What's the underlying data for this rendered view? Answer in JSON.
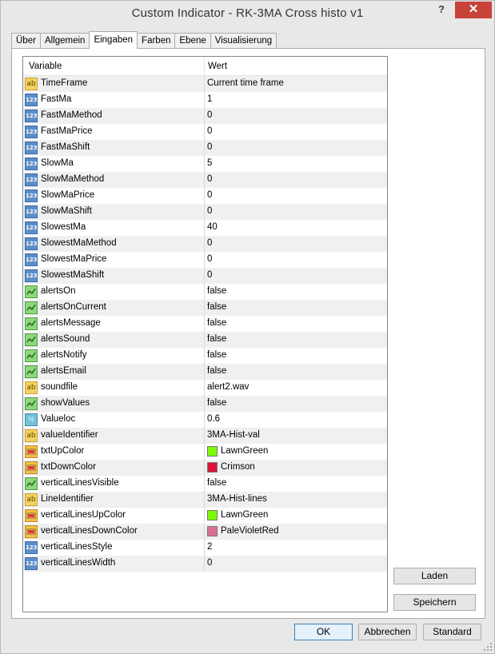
{
  "window": {
    "title": "Custom Indicator - RK-3MA Cross histo v1",
    "help_label": "?",
    "close_label": "✕"
  },
  "tabs": [
    "Über",
    "Allgemein",
    "Eingaben",
    "Farben",
    "Ebene",
    "Visualisierung"
  ],
  "active_tab": "Eingaben",
  "grid": {
    "col_variable": "Variable",
    "col_value": "Wert",
    "rows": [
      {
        "type": "string",
        "icon": "string-type-icon",
        "icon_text": "ab",
        "name": "TimeFrame",
        "value": "Current time frame"
      },
      {
        "type": "int",
        "icon": "integer-type-icon",
        "icon_text": "123",
        "name": "FastMa",
        "value": "1"
      },
      {
        "type": "int",
        "icon": "integer-type-icon",
        "icon_text": "123",
        "name": "FastMaMethod",
        "value": "0"
      },
      {
        "type": "int",
        "icon": "integer-type-icon",
        "icon_text": "123",
        "name": "FastMaPrice",
        "value": "0"
      },
      {
        "type": "int",
        "icon": "integer-type-icon",
        "icon_text": "123",
        "name": "FastMaShift",
        "value": "0"
      },
      {
        "type": "int",
        "icon": "integer-type-icon",
        "icon_text": "123",
        "name": "SlowMa",
        "value": "5"
      },
      {
        "type": "int",
        "icon": "integer-type-icon",
        "icon_text": "123",
        "name": "SlowMaMethod",
        "value": "0"
      },
      {
        "type": "int",
        "icon": "integer-type-icon",
        "icon_text": "123",
        "name": "SlowMaPrice",
        "value": "0"
      },
      {
        "type": "int",
        "icon": "integer-type-icon",
        "icon_text": "123",
        "name": "SlowMaShift",
        "value": "0"
      },
      {
        "type": "int",
        "icon": "integer-type-icon",
        "icon_text": "123",
        "name": "SlowestMa",
        "value": "40"
      },
      {
        "type": "int",
        "icon": "integer-type-icon",
        "icon_text": "123",
        "name": "SlowestMaMethod",
        "value": "0"
      },
      {
        "type": "int",
        "icon": "integer-type-icon",
        "icon_text": "123",
        "name": "SlowestMaPrice",
        "value": "0"
      },
      {
        "type": "int",
        "icon": "integer-type-icon",
        "icon_text": "123",
        "name": "SlowestMaShift",
        "value": "0"
      },
      {
        "type": "bool",
        "icon": "boolean-type-icon",
        "icon_text": "",
        "name": "alertsOn",
        "value": "false"
      },
      {
        "type": "bool",
        "icon": "boolean-type-icon",
        "icon_text": "",
        "name": "alertsOnCurrent",
        "value": "false"
      },
      {
        "type": "bool",
        "icon": "boolean-type-icon",
        "icon_text": "",
        "name": "alertsMessage",
        "value": "false"
      },
      {
        "type": "bool",
        "icon": "boolean-type-icon",
        "icon_text": "",
        "name": "alertsSound",
        "value": "false"
      },
      {
        "type": "bool",
        "icon": "boolean-type-icon",
        "icon_text": "",
        "name": "alertsNotify",
        "value": "false"
      },
      {
        "type": "bool",
        "icon": "boolean-type-icon",
        "icon_text": "",
        "name": "alertsEmail",
        "value": "false"
      },
      {
        "type": "string",
        "icon": "string-type-icon",
        "icon_text": "ab",
        "name": "soundfile",
        "value": "alert2.wav"
      },
      {
        "type": "bool",
        "icon": "boolean-type-icon",
        "icon_text": "",
        "name": "showValues",
        "value": "false"
      },
      {
        "type": "double",
        "icon": "double-type-icon",
        "icon_text": "½",
        "name": "Valueloc",
        "value": "0.6"
      },
      {
        "type": "string",
        "icon": "string-type-icon",
        "icon_text": "ab",
        "name": "valueIdentifier",
        "value": "3MA-Hist-val"
      },
      {
        "type": "color",
        "icon": "color-type-icon",
        "icon_text": "",
        "name": "txtUpColor",
        "value": "LawnGreen",
        "swatch": "#7cfc00"
      },
      {
        "type": "color",
        "icon": "color-type-icon",
        "icon_text": "",
        "name": "txtDownColor",
        "value": "Crimson",
        "swatch": "#dc143c"
      },
      {
        "type": "bool",
        "icon": "boolean-type-icon",
        "icon_text": "",
        "name": "verticalLinesVisible",
        "value": "false"
      },
      {
        "type": "string",
        "icon": "string-type-icon",
        "icon_text": "ab",
        "name": "LineIdentifier",
        "value": "3MA-Hist-lines"
      },
      {
        "type": "color",
        "icon": "color-type-icon",
        "icon_text": "",
        "name": "verticalLinesUpColor",
        "value": "LawnGreen",
        "swatch": "#7cfc00"
      },
      {
        "type": "color",
        "icon": "color-type-icon",
        "icon_text": "",
        "name": "verticalLinesDownColor",
        "value": "PaleVioletRed",
        "swatch": "#db7093"
      },
      {
        "type": "int",
        "icon": "integer-type-icon",
        "icon_text": "123",
        "name": "verticalLinesStyle",
        "value": "2"
      },
      {
        "type": "int",
        "icon": "integer-type-icon",
        "icon_text": "123",
        "name": "verticalLinesWidth",
        "value": "0"
      }
    ]
  },
  "side_buttons": {
    "load": "Laden",
    "save": "Speichern"
  },
  "footer_buttons": {
    "ok": "OK",
    "cancel": "Abbrechen",
    "default": "Standard"
  }
}
